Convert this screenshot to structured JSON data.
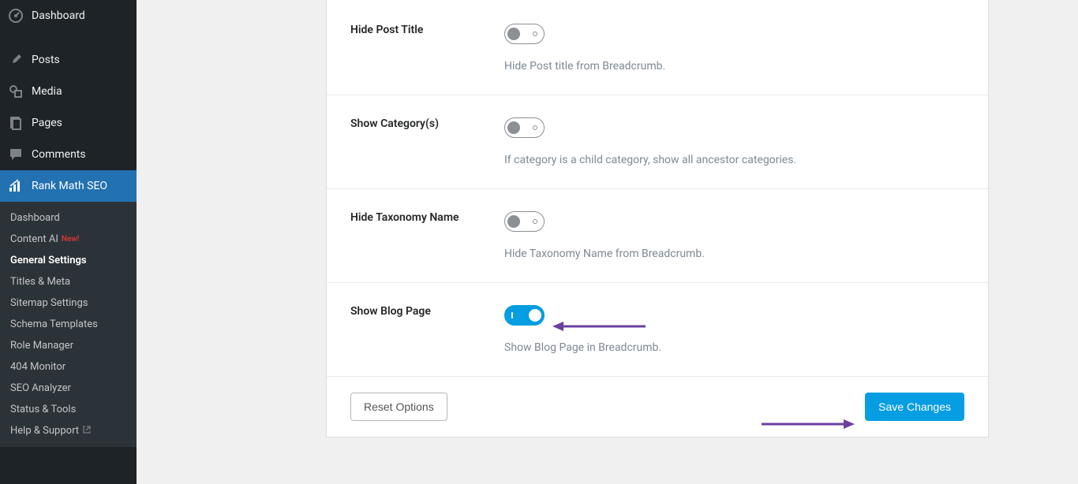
{
  "sidebar": {
    "main": [
      {
        "icon": "dashboard",
        "label": "Dashboard"
      },
      {
        "icon": "pin",
        "label": "Posts"
      },
      {
        "icon": "media",
        "label": "Media"
      },
      {
        "icon": "pages",
        "label": "Pages"
      },
      {
        "icon": "comments",
        "label": "Comments"
      },
      {
        "icon": "rankmath",
        "label": "Rank Math SEO",
        "active": true
      }
    ],
    "sub": [
      {
        "label": "Dashboard"
      },
      {
        "label": "Content AI",
        "badge": "New!"
      },
      {
        "label": "General Settings",
        "current": true
      },
      {
        "label": "Titles & Meta"
      },
      {
        "label": "Sitemap Settings"
      },
      {
        "label": "Schema Templates"
      },
      {
        "label": "Role Manager"
      },
      {
        "label": "404 Monitor"
      },
      {
        "label": "SEO Analyzer"
      },
      {
        "label": "Status & Tools"
      },
      {
        "label": "Help & Support",
        "external": true
      }
    ]
  },
  "settings": {
    "rows": [
      {
        "label": "Hide Post Title",
        "desc": "Hide Post title from Breadcrumb.",
        "on": false
      },
      {
        "label": "Show Category(s)",
        "desc": "If category is a child category, show all ancestor categories.",
        "on": false
      },
      {
        "label": "Hide Taxonomy Name",
        "desc": "Hide Taxonomy Name from Breadcrumb.",
        "on": false
      },
      {
        "label": "Show Blog Page",
        "desc": "Show Blog Page in Breadcrumb.",
        "on": true
      }
    ]
  },
  "buttons": {
    "reset": "Reset Options",
    "save": "Save Changes"
  }
}
